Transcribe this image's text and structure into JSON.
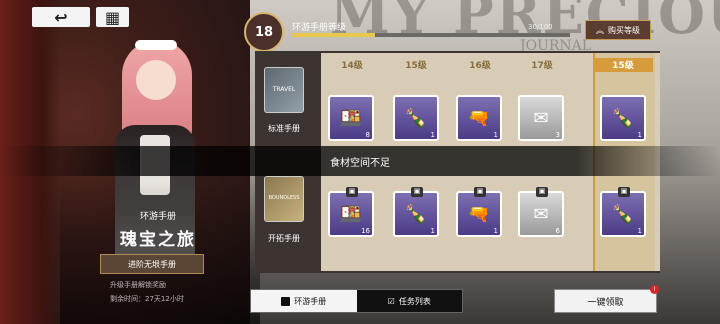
{
  "top_nav": {
    "back_icon": "back-arrow-icon",
    "home_icon": "home-icon"
  },
  "level": {
    "current": "18",
    "title": "环游手册等级",
    "xp_text": "30/100",
    "xp_progress": 0.3,
    "buy_label": "购买等级",
    "buy_icon": "double-chevron-up-icon"
  },
  "passport": {
    "type_label": "环游手册",
    "name": "瑰宝之旅",
    "advance_label": "进阶无垠手册",
    "upgrade_note": "升级手册解锁奖励",
    "time_remaining": "剩余时间：27天12小时"
  },
  "tracks": {
    "standard": {
      "label": "标准手册",
      "card_text": "TRAVEL"
    },
    "boundless": {
      "label": "开拓手册",
      "card_text": "BOUNDLESS"
    }
  },
  "levels": [
    "14级",
    "15级",
    "16级",
    "17级"
  ],
  "sticky_level": "15级",
  "standard_rewards": [
    {
      "icon": "food-icon",
      "qty": "8",
      "rarity": "purple"
    },
    {
      "icon": "green-bottle-icon",
      "qty": "1",
      "rarity": "purple"
    },
    {
      "icon": "weapon-icon",
      "qty": "1",
      "rarity": "purple"
    },
    {
      "icon": "letter-icon",
      "qty": "3",
      "rarity": "gray"
    }
  ],
  "boundless_rewards": [
    {
      "icon": "food-icon",
      "qty": "16",
      "rarity": "purple"
    },
    {
      "icon": "green-bottle-icon",
      "qty": "1",
      "rarity": "purple"
    },
    {
      "icon": "weapon-icon",
      "qty": "1",
      "rarity": "purple"
    },
    {
      "icon": "letter-icon",
      "qty": "6",
      "rarity": "gray"
    }
  ],
  "sticky_standard": {
    "icon": "green-bottle-icon",
    "qty": "1"
  },
  "sticky_boundless": {
    "icon": "green-bottle-icon",
    "qty": "1"
  },
  "toast": "食材空间不足",
  "tabs": [
    {
      "label": "环游手册",
      "icon": "book-icon",
      "active": true
    },
    {
      "label": "任务列表",
      "icon": "checkbox-icon",
      "active": false
    }
  ],
  "claim_all": "一键领取",
  "claim_badge": "!",
  "background": {
    "headline": "MY PRECIOUS",
    "subhead": "JOURNAL"
  },
  "colors": {
    "accent_gold": "#d69b3a",
    "purple_rarity": "#4c3a87",
    "xp_fill": "#e8c84a"
  }
}
